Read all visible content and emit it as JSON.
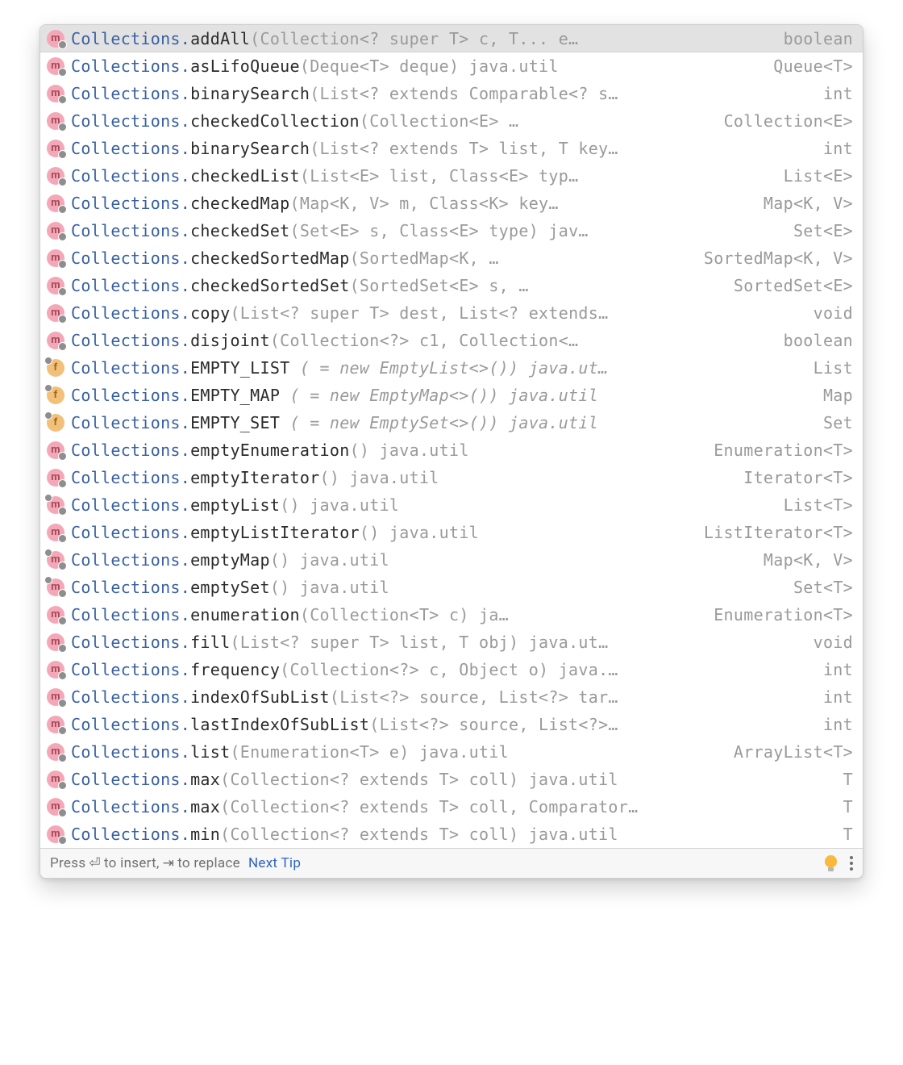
{
  "footer": {
    "hint_press": "Press",
    "hint_insert1": "to insert,",
    "hint_replace": "to replace",
    "next_tip": "Next Tip",
    "enter_glyph": "⏎",
    "tab_glyph": "⇥"
  },
  "suggestions": [
    {
      "icon": "m",
      "badge_br": true,
      "badge_tl": false,
      "class": "Collections.",
      "member": "addAll",
      "sig": "(Collection<? super T> c, T... e…",
      "sig_italic": false,
      "ret": "boolean",
      "selected": true
    },
    {
      "icon": "m",
      "badge_br": true,
      "badge_tl": false,
      "class": "Collections.",
      "member": "asLifoQueue",
      "sig": "(Deque<T> deque) java.util",
      "sig_italic": false,
      "ret": "Queue<T>",
      "selected": false
    },
    {
      "icon": "m",
      "badge_br": true,
      "badge_tl": false,
      "class": "Collections.",
      "member": "binarySearch",
      "sig": "(List<? extends Comparable<? s…",
      "sig_italic": false,
      "ret": "int",
      "selected": false
    },
    {
      "icon": "m",
      "badge_br": true,
      "badge_tl": false,
      "class": "Collections.",
      "member": "checkedCollection",
      "sig": "(Collection<E> …",
      "sig_italic": false,
      "ret": "Collection<E>",
      "selected": false
    },
    {
      "icon": "m",
      "badge_br": true,
      "badge_tl": false,
      "class": "Collections.",
      "member": "binarySearch",
      "sig": "(List<? extends T> list, T key…",
      "sig_italic": false,
      "ret": "int",
      "selected": false
    },
    {
      "icon": "m",
      "badge_br": true,
      "badge_tl": false,
      "class": "Collections.",
      "member": "checkedList",
      "sig": "(List<E> list, Class<E> typ…",
      "sig_italic": false,
      "ret": "List<E>",
      "selected": false
    },
    {
      "icon": "m",
      "badge_br": true,
      "badge_tl": false,
      "class": "Collections.",
      "member": "checkedMap",
      "sig": "(Map<K, V> m, Class<K> key…",
      "sig_italic": false,
      "ret": "Map<K, V>",
      "selected": false
    },
    {
      "icon": "m",
      "badge_br": true,
      "badge_tl": false,
      "class": "Collections.",
      "member": "checkedSet",
      "sig": "(Set<E> s, Class<E> type) jav…",
      "sig_italic": false,
      "ret": "Set<E>",
      "selected": false
    },
    {
      "icon": "m",
      "badge_br": true,
      "badge_tl": false,
      "class": "Collections.",
      "member": "checkedSortedMap",
      "sig": "(SortedMap<K, …",
      "sig_italic": false,
      "ret": "SortedMap<K, V>",
      "selected": false
    },
    {
      "icon": "m",
      "badge_br": true,
      "badge_tl": false,
      "class": "Collections.",
      "member": "checkedSortedSet",
      "sig": "(SortedSet<E> s, …",
      "sig_italic": false,
      "ret": "SortedSet<E>",
      "selected": false
    },
    {
      "icon": "m",
      "badge_br": true,
      "badge_tl": false,
      "class": "Collections.",
      "member": "copy",
      "sig": "(List<? super T> dest, List<? extends…",
      "sig_italic": false,
      "ret": "void",
      "selected": false
    },
    {
      "icon": "m",
      "badge_br": true,
      "badge_tl": false,
      "class": "Collections.",
      "member": "disjoint",
      "sig": "(Collection<?> c1, Collection<…",
      "sig_italic": false,
      "ret": "boolean",
      "selected": false
    },
    {
      "icon": "f",
      "badge_br": false,
      "badge_tl": true,
      "class": "Collections.",
      "member": "EMPTY_LIST",
      "sig": " ( = new EmptyList<>()) java.ut…",
      "sig_italic": true,
      "ret": "List",
      "selected": false
    },
    {
      "icon": "f",
      "badge_br": false,
      "badge_tl": true,
      "class": "Collections.",
      "member": "EMPTY_MAP",
      "sig": " ( = new EmptyMap<>()) java.util",
      "sig_italic": true,
      "ret": "Map",
      "selected": false
    },
    {
      "icon": "f",
      "badge_br": false,
      "badge_tl": true,
      "class": "Collections.",
      "member": "EMPTY_SET",
      "sig": " ( = new EmptySet<>()) java.util",
      "sig_italic": true,
      "ret": "Set",
      "selected": false
    },
    {
      "icon": "m",
      "badge_br": true,
      "badge_tl": false,
      "class": "Collections.",
      "member": "emptyEnumeration",
      "sig": "() java.util",
      "sig_italic": false,
      "ret": "Enumeration<T>",
      "selected": false
    },
    {
      "icon": "m",
      "badge_br": true,
      "badge_tl": false,
      "class": "Collections.",
      "member": "emptyIterator",
      "sig": "() java.util",
      "sig_italic": false,
      "ret": "Iterator<T>",
      "selected": false
    },
    {
      "icon": "m",
      "badge_br": true,
      "badge_tl": true,
      "class": "Collections.",
      "member": "emptyList",
      "sig": "() java.util",
      "sig_italic": false,
      "ret": "List<T>",
      "selected": false
    },
    {
      "icon": "m",
      "badge_br": true,
      "badge_tl": false,
      "class": "Collections.",
      "member": "emptyListIterator",
      "sig": "() java.util",
      "sig_italic": false,
      "ret": "ListIterator<T>",
      "selected": false
    },
    {
      "icon": "m",
      "badge_br": true,
      "badge_tl": true,
      "class": "Collections.",
      "member": "emptyMap",
      "sig": "() java.util",
      "sig_italic": false,
      "ret": "Map<K, V>",
      "selected": false
    },
    {
      "icon": "m",
      "badge_br": true,
      "badge_tl": true,
      "class": "Collections.",
      "member": "emptySet",
      "sig": "() java.util",
      "sig_italic": false,
      "ret": "Set<T>",
      "selected": false
    },
    {
      "icon": "m",
      "badge_br": true,
      "badge_tl": false,
      "class": "Collections.",
      "member": "enumeration",
      "sig": "(Collection<T> c) ja…",
      "sig_italic": false,
      "ret": "Enumeration<T>",
      "selected": false
    },
    {
      "icon": "m",
      "badge_br": true,
      "badge_tl": false,
      "class": "Collections.",
      "member": "fill",
      "sig": "(List<? super T> list, T obj) java.ut…",
      "sig_italic": false,
      "ret": "void",
      "selected": false
    },
    {
      "icon": "m",
      "badge_br": true,
      "badge_tl": false,
      "class": "Collections.",
      "member": "frequency",
      "sig": "(Collection<?> c, Object o) java.…",
      "sig_italic": false,
      "ret": "int",
      "selected": false
    },
    {
      "icon": "m",
      "badge_br": true,
      "badge_tl": false,
      "class": "Collections.",
      "member": "indexOfSubList",
      "sig": "(List<?> source, List<?> tar…",
      "sig_italic": false,
      "ret": "int",
      "selected": false
    },
    {
      "icon": "m",
      "badge_br": true,
      "badge_tl": false,
      "class": "Collections.",
      "member": "lastIndexOfSubList",
      "sig": "(List<?> source, List<?>…",
      "sig_italic": false,
      "ret": "int",
      "selected": false
    },
    {
      "icon": "m",
      "badge_br": true,
      "badge_tl": false,
      "class": "Collections.",
      "member": "list",
      "sig": "(Enumeration<T> e) java.util",
      "sig_italic": false,
      "ret": "ArrayList<T>",
      "selected": false
    },
    {
      "icon": "m",
      "badge_br": true,
      "badge_tl": false,
      "class": "Collections.",
      "member": "max",
      "sig": "(Collection<? extends T> coll) java.util",
      "sig_italic": false,
      "ret": "T",
      "selected": false
    },
    {
      "icon": "m",
      "badge_br": true,
      "badge_tl": false,
      "class": "Collections.",
      "member": "max",
      "sig": "(Collection<? extends T> coll, Comparator…",
      "sig_italic": false,
      "ret": "T",
      "selected": false
    },
    {
      "icon": "m",
      "badge_br": true,
      "badge_tl": false,
      "class": "Collections.",
      "member": "min",
      "sig": "(Collection<? extends T> coll) java.util",
      "sig_italic": false,
      "ret": "T",
      "selected": false
    }
  ]
}
